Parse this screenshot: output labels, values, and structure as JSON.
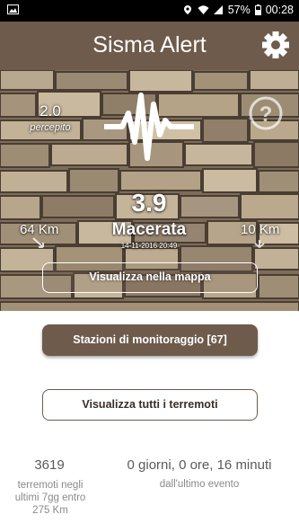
{
  "status_bar": {
    "battery": "57%",
    "time": "00:28",
    "icons": [
      "image-icon",
      "location-icon",
      "wifi-icon",
      "signal-icon",
      "battery-icon"
    ]
  },
  "app_bar": {
    "title": "Sisma Alert",
    "settings_icon": "gear-icon"
  },
  "event": {
    "perceived_value": "2.0",
    "perceived_label": "percepito",
    "magnitude": "3.9",
    "place": "Macerata",
    "datetime": "14-11-2016 20:49",
    "distance_left": "64 Km",
    "distance_right": "10 Km",
    "help_icon": "question-circle-icon",
    "wave_icon": "seismograph-icon"
  },
  "buttons": {
    "map": "Visualizza nella mappa",
    "stations": "Stazioni di monitoraggio [67]",
    "all_quakes": "Visualizza tutti i terremoti"
  },
  "stats": {
    "count_value": "3619",
    "count_label": "terremoti negli ultimi 7gg entro 275 Km",
    "elapsed_value": "0 giorni, 0 ore, 16 minuti",
    "elapsed_label": "dall'ultimo evento"
  },
  "colors": {
    "app_bar": "#6e5b4c",
    "status_bar": "#000000",
    "text_muted": "#8a8a8a"
  }
}
